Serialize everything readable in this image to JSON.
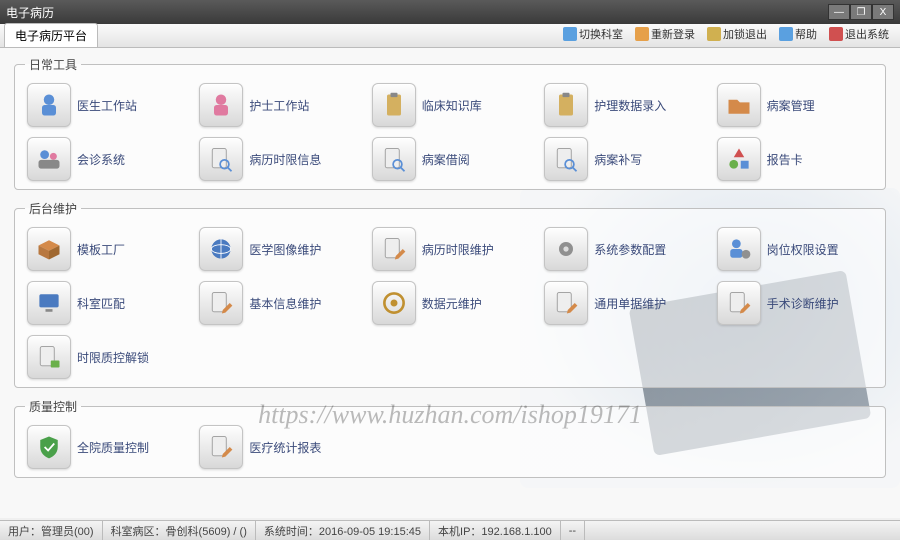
{
  "titlebar": {
    "title": "电子病历"
  },
  "tab": {
    "label": "电子病历平台"
  },
  "toolbar": {
    "btn1": "切换科室",
    "btn2": "重新登录",
    "btn3": "加锁退出",
    "btn4": "帮助",
    "btn5": "退出系统"
  },
  "sections": {
    "daily": {
      "title": "日常工具",
      "items": [
        {
          "label": "医生工作站",
          "icon": "doctor"
        },
        {
          "label": "护士工作站",
          "icon": "nurse"
        },
        {
          "label": "临床知识库",
          "icon": "clipboard"
        },
        {
          "label": "护理数据录入",
          "icon": "clipboard"
        },
        {
          "label": "病案管理",
          "icon": "folder"
        },
        {
          "label": "会诊系统",
          "icon": "people"
        },
        {
          "label": "病历时限信息",
          "icon": "doc-search"
        },
        {
          "label": "病案借阅",
          "icon": "doc-search"
        },
        {
          "label": "病案补写",
          "icon": "doc-search"
        },
        {
          "label": "报告卡",
          "icon": "shapes"
        }
      ]
    },
    "maint": {
      "title": "后台维护",
      "items": [
        {
          "label": "模板工厂",
          "icon": "box"
        },
        {
          "label": "医学图像维护",
          "icon": "globe"
        },
        {
          "label": "病历时限维护",
          "icon": "doc-edit"
        },
        {
          "label": "系统参数配置",
          "icon": "gear"
        },
        {
          "label": "岗位权限设置",
          "icon": "user-gear"
        },
        {
          "label": "科室匹配",
          "icon": "monitor"
        },
        {
          "label": "基本信息维护",
          "icon": "doc-edit"
        },
        {
          "label": "数据元维护",
          "icon": "at"
        },
        {
          "label": "通用单据维护",
          "icon": "doc-edit"
        },
        {
          "label": "手术诊断维护",
          "icon": "doc-edit"
        },
        {
          "label": "时限质控解锁",
          "icon": "doc-lock"
        }
      ]
    },
    "quality": {
      "title": "质量控制",
      "items": [
        {
          "label": "全院质量控制",
          "icon": "shield"
        },
        {
          "label": "医疗统计报表",
          "icon": "doc-edit"
        }
      ]
    }
  },
  "statusbar": {
    "user_label": "用户：管理员(00)",
    "dept_label": "科室病区：骨创科(5609) / ()",
    "time_label": "系统时间：2016-09-05 19:15:45",
    "ip_label": "本机IP：192.168.1.100",
    "extra": "--"
  },
  "watermark": "https://www.huzhan.com/ishop19171"
}
